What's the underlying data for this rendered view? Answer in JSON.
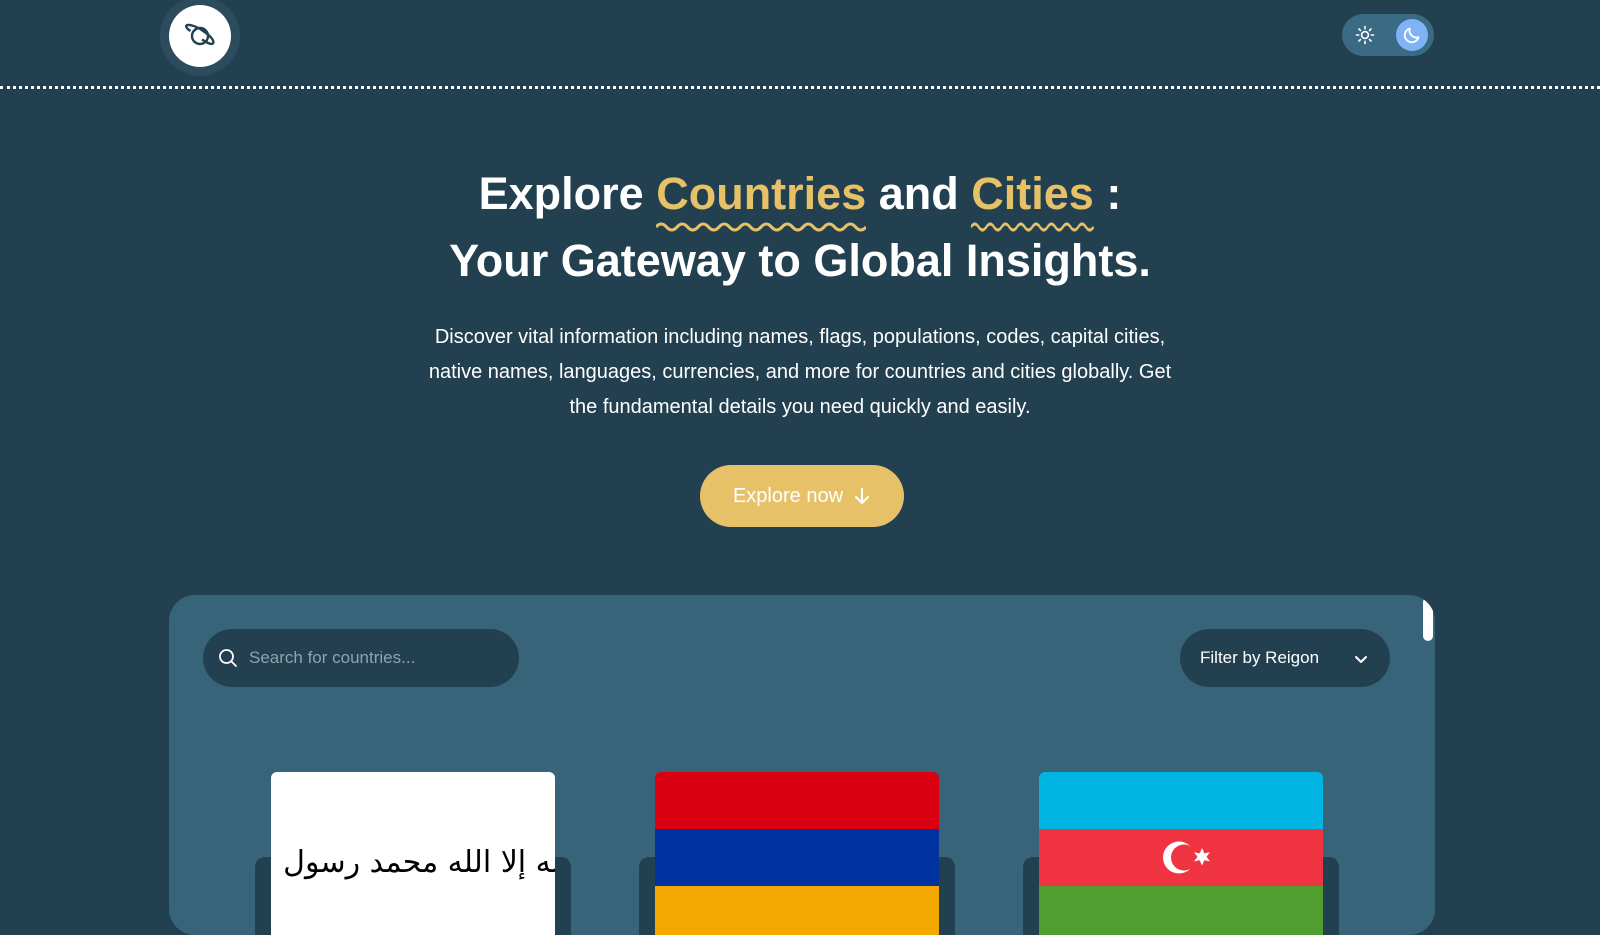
{
  "header": {
    "logo_icon": "planet-icon",
    "theme_toggle": {
      "light_icon": "sun-icon",
      "dark_icon": "moon-icon",
      "active": "dark"
    }
  },
  "hero": {
    "title_part1": "Explore",
    "title_countries": "Countries",
    "title_and": "and",
    "title_cities": "Cities",
    "title_colon": ":",
    "title_line2": "Your Gateway to Global Insights.",
    "description": "Discover vital information including names, flags, populations, codes, capital cities, native names, languages, currencies, and more for countries and cities globally. Get the fundamental details you need quickly and easily.",
    "cta_label": "Explore now",
    "cta_icon": "arrow-down-icon"
  },
  "search": {
    "placeholder": "Search for countries...",
    "value": "",
    "icon": "search-icon"
  },
  "filter": {
    "label": "Filter by Reigon",
    "icon": "chevron-down-icon"
  },
  "countries": [
    {
      "flag": "afghanistan-flag",
      "flag_text": "لا إله إلا الله محمد رسول الله"
    },
    {
      "flag": "armenia-flag"
    },
    {
      "flag": "azerbaijan-flag"
    }
  ],
  "colors": {
    "background": "#234050",
    "panel": "#386479",
    "accent": "#e6c168",
    "toggle_active": "#7fb3f5"
  }
}
